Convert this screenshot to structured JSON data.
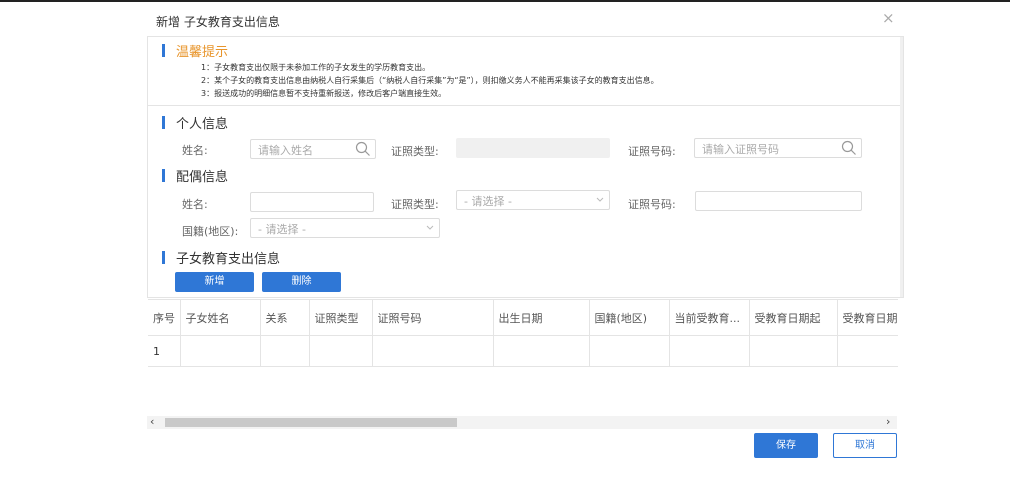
{
  "dialog": {
    "title": "新增 子女教育支出信息",
    "close": "×"
  },
  "tips": {
    "title": "温馨提示",
    "lines": [
      "1：子女教育支出仅限于未参加工作的子女发生的学历教育支出。",
      "2：某个子女的教育支出信息由纳税人自行采集后（“纳税人自行采集”为“是”），则扣缴义务人不能再采集该子女的教育支出信息。",
      "3：报送成功的明细信息暂不支持重新报送，修改后客户端直接生效。"
    ]
  },
  "personal": {
    "title": "个人信息",
    "name_label": "姓名:",
    "name_placeholder": "请输入姓名",
    "idtype_label": "证照类型:",
    "idno_label": "证照号码:",
    "idno_placeholder": "请输入证照号码"
  },
  "spouse": {
    "title": "配偶信息",
    "name_label": "姓名:",
    "idtype_label": "证照类型:",
    "idtype_value": "- 请选择 -",
    "idno_label": "证照号码:",
    "nationality_label": "国籍(地区):",
    "nationality_value": "- 请选择 -"
  },
  "children": {
    "title": "子女教育支出信息",
    "add_label": "新增",
    "delete_label": "删除",
    "columns": [
      "序号",
      "子女姓名",
      "关系",
      "证照类型",
      "证照号码",
      "出生日期",
      "国籍(地区)",
      "当前受教育...",
      "受教育日期起",
      "受教育日期"
    ],
    "rows": [
      [
        "1",
        "",
        "",
        "",
        "",
        "",
        "",
        "",
        "",
        ""
      ]
    ]
  },
  "scrollbar": {
    "left_arrow": "‹",
    "right_arrow": "›"
  },
  "footer": {
    "save_label": "保存",
    "cancel_label": "取消"
  },
  "colors": {
    "accent": "#2f77d6",
    "tip_title": "#e8952b"
  }
}
